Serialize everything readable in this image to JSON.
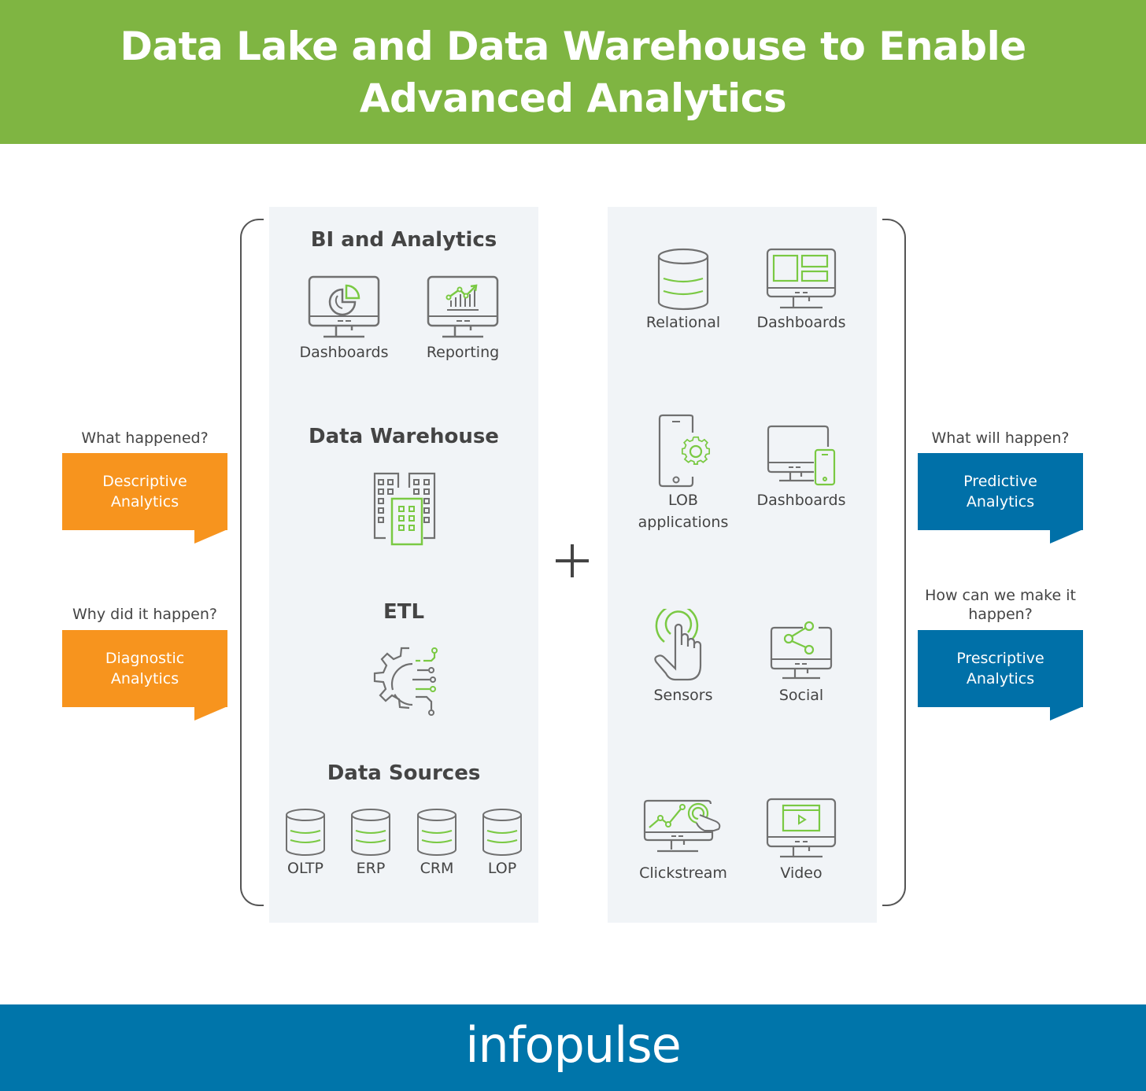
{
  "header": {
    "title_line1": "Data Lake and Data Warehouse to Enable",
    "title_line2": "Advanced Analytics",
    "background": "#7fb542"
  },
  "left_panel": {
    "sections": [
      {
        "title": "BI and Analytics",
        "items": [
          {
            "label": "Dashboards",
            "icon": "monitor-pie-chart-icon"
          },
          {
            "label": "Reporting",
            "icon": "monitor-bar-chart-icon"
          }
        ]
      },
      {
        "title": "Data Warehouse",
        "icon": "buildings-icon"
      },
      {
        "title": "ETL",
        "icon": "gear-circuit-icon"
      },
      {
        "title": "Data Sources",
        "items": [
          {
            "label": "OLTP",
            "icon": "database-icon"
          },
          {
            "label": "ERP",
            "icon": "database-icon"
          },
          {
            "label": "CRM",
            "icon": "database-icon"
          },
          {
            "label": "LOP",
            "icon": "database-icon"
          }
        ]
      }
    ]
  },
  "connector": {
    "symbol": "+"
  },
  "right_panel": {
    "items": [
      {
        "label": "Relational",
        "icon": "database-icon"
      },
      {
        "label": "Dashboards",
        "icon": "monitor-layout-icon"
      },
      {
        "label": "LOB applications",
        "label_line1": "LOB",
        "label_line2": "applications",
        "icon": "phone-gear-icon"
      },
      {
        "label": "Dashboards",
        "icon": "monitor-phone-icon"
      },
      {
        "label": "Sensors",
        "icon": "hand-touch-icon"
      },
      {
        "label": "Social",
        "icon": "monitor-share-icon"
      },
      {
        "label": "Clickstream",
        "icon": "monitor-click-chart-icon"
      },
      {
        "label": "Video",
        "icon": "monitor-video-icon"
      }
    ]
  },
  "callouts_left": [
    {
      "question": "What happened?",
      "line1": "Descriptive",
      "line2": "Analytics",
      "color": "#f7941e"
    },
    {
      "question": "Why did it happen?",
      "line1": "Diagnostic",
      "line2": "Analytics",
      "color": "#f7941e"
    }
  ],
  "callouts_right": [
    {
      "question": "What will happen?",
      "question_line1": "What will happen?",
      "line1": "Predictive",
      "line2": "Analytics",
      "color": "#0070a8"
    },
    {
      "question": "How can we make it happen?",
      "question_line1": "How can we make it",
      "question_line2": "happen?",
      "line1": "Prescriptive",
      "line2": "Analytics",
      "color": "#0070a8"
    }
  ],
  "footer": {
    "logo": "infopulse",
    "background": "#0075aa"
  },
  "colors": {
    "accent_green": "#7ac943",
    "icon_gray": "#707070",
    "panel_bg": "#f1f4f7"
  }
}
